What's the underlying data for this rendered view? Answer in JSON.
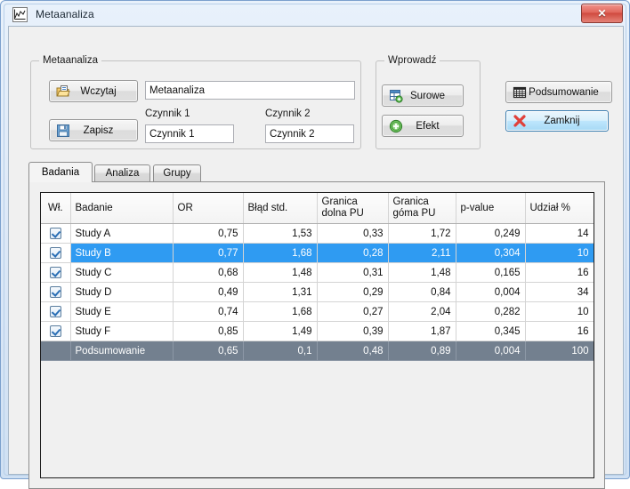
{
  "window": {
    "title": "Metaanaliza",
    "app_icon": "chart-icon",
    "close_label": "✕"
  },
  "groups": {
    "meta": {
      "title": "Metaanaliza",
      "load_button": "Wczytaj",
      "save_button": "Zapisz",
      "name_value": "Metaanaliza",
      "factor1_label": "Czynnik 1",
      "factor1_value": "Czynnik 1",
      "factor2_label": "Czynnik 2",
      "factor2_value": "Czynnik 2"
    },
    "wprowadz": {
      "title": "Wprowadź",
      "raw_button": "Surowe",
      "effect_button": "Efekt"
    }
  },
  "actions": {
    "summary_button": "Podsumowanie",
    "close_button": "Zamknij"
  },
  "tabs": [
    {
      "label": "Badania",
      "active": true
    },
    {
      "label": "Analiza",
      "active": false
    },
    {
      "label": "Grupy",
      "active": false
    }
  ],
  "table": {
    "headers": [
      "Wł.",
      "Badanie",
      "OR",
      "Błąd std.",
      "Granica\ndolna PU",
      "Granica\ngóma PU",
      "p-value",
      "Udział %"
    ],
    "rows": [
      {
        "checked": true,
        "name": "Study A",
        "or": "0,75",
        "sd": "1,53",
        "lower": "0,33",
        "upper": "1,72",
        "pvalue": "0,249",
        "weight": "14",
        "state": "normal"
      },
      {
        "checked": true,
        "name": "Study B",
        "or": "0,77",
        "sd": "1,68",
        "lower": "0,28",
        "upper": "2,11",
        "pvalue": "0,304",
        "weight": "10",
        "state": "selected"
      },
      {
        "checked": true,
        "name": "Study C",
        "or": "0,68",
        "sd": "1,48",
        "lower": "0,31",
        "upper": "1,48",
        "pvalue": "0,165",
        "weight": "16",
        "state": "normal"
      },
      {
        "checked": true,
        "name": "Study D",
        "or": "0,49",
        "sd": "1,31",
        "lower": "0,29",
        "upper": "0,84",
        "pvalue": "0,004",
        "weight": "34",
        "state": "normal"
      },
      {
        "checked": true,
        "name": "Study E",
        "or": "0,74",
        "sd": "1,68",
        "lower": "0,27",
        "upper": "2,04",
        "pvalue": "0,282",
        "weight": "10",
        "state": "normal"
      },
      {
        "checked": true,
        "name": "Study F",
        "or": "0,85",
        "sd": "1,49",
        "lower": "0,39",
        "upper": "1,87",
        "pvalue": "0,345",
        "weight": "16",
        "state": "normal"
      },
      {
        "checked": false,
        "name": "Podsumowanie",
        "or": "0,65",
        "sd": "0,1",
        "lower": "0,48",
        "upper": "0,89",
        "pvalue": "0,004",
        "weight": "100",
        "state": "summary"
      }
    ]
  },
  "colors": {
    "selection": "#2f9bf2",
    "summary_row": "#73808f",
    "window_frame": "#cfe0f3",
    "close_red": "#d04a3e",
    "focus_blue": "#3c7fb1"
  }
}
